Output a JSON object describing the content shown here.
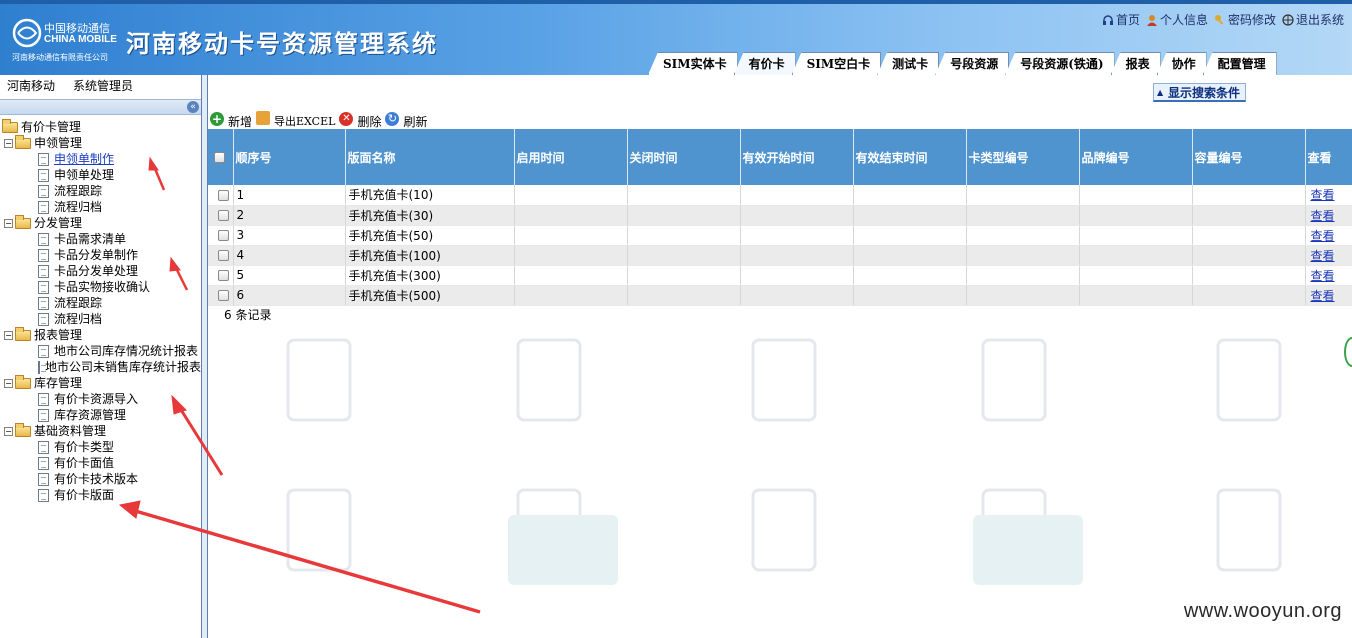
{
  "header": {
    "logo_cn": "中国移动通信",
    "logo_en": "CHINA MOBILE",
    "logo_sub": "河南移动通信有限责任公司",
    "title": "河南移动卡号资源管理系统",
    "links": [
      {
        "label": "首页",
        "icon": "headset-icon"
      },
      {
        "label": "个人信息",
        "icon": "user-icon"
      },
      {
        "label": "密码修改",
        "icon": "key-icon"
      },
      {
        "label": "退出系统",
        "icon": "exit-icon"
      }
    ],
    "tabs": [
      "SIM实体卡",
      "有价卡",
      "SIM空白卡",
      "测试卡",
      "号段资源",
      "号段资源(铁通)",
      "报表",
      "协作",
      "配置管理"
    ],
    "active_tab": "有价卡"
  },
  "sidebar": {
    "org": "河南移动",
    "user": "系统管理员",
    "root": "有价卡管理",
    "groups": [
      {
        "label": "申领管理",
        "items": [
          "申领单制作",
          "申领单处理",
          "流程跟踪",
          "流程归档"
        ]
      },
      {
        "label": "分发管理",
        "items": [
          "卡品需求清单",
          "卡品分发单制作",
          "卡品分发单处理",
          "卡品实物接收确认",
          "流程跟踪",
          "流程归档"
        ]
      },
      {
        "label": "报表管理",
        "items": [
          "地市公司库存情况统计报表",
          "地市公司未销售库存统计报表"
        ]
      },
      {
        "label": "库存管理",
        "items": [
          "有价卡资源导入",
          "库存资源管理"
        ]
      },
      {
        "label": "基础资料管理",
        "items": [
          "有价卡类型",
          "有价卡面值",
          "有价卡技术版本",
          "有价卡版面"
        ]
      }
    ]
  },
  "main": {
    "show_search": "显示搜索条件",
    "toolbar": {
      "add": "新增",
      "export": "导出EXCEL",
      "delete": "删除",
      "refresh": "刷新"
    },
    "columns": [
      "顺序号",
      "版面名称",
      "启用时间",
      "关闭时间",
      "有效开始时间",
      "有效结束时间",
      "卡类型编号",
      "品牌编号",
      "容量编号",
      "查看"
    ],
    "rows": [
      {
        "seq": "1",
        "name": "手机充值卡(10)",
        "action": "查看"
      },
      {
        "seq": "2",
        "name": "手机充值卡(30)",
        "action": "查看"
      },
      {
        "seq": "3",
        "name": "手机充值卡(50)",
        "action": "查看"
      },
      {
        "seq": "4",
        "name": "手机充值卡(100)",
        "action": "查看"
      },
      {
        "seq": "5",
        "name": "手机充值卡(300)",
        "action": "查看"
      },
      {
        "seq": "6",
        "name": "手机充值卡(500)",
        "action": "查看"
      }
    ],
    "record_count": "6 条记录"
  },
  "watermark": "www.wooyun.org",
  "colors": {
    "header_blue": "#2f7fd0",
    "grid_header": "#4f94cf",
    "link": "#1a36b8",
    "arrow": "#e8393a"
  }
}
